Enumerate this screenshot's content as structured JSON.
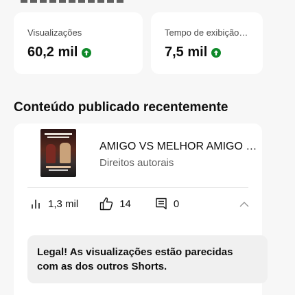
{
  "stats": [
    {
      "label": "Visualizações",
      "value": "60,2 mil",
      "trend_icon": "arrow-up-circle-icon"
    },
    {
      "label": "Tempo de exibição (h...",
      "value": "7,5 mil",
      "trend_icon": "arrow-up-circle-icon"
    }
  ],
  "section": {
    "title": "Conteúdo publicado recentemente"
  },
  "video": {
    "title": "AMIGO VS MELHOR AMIGO @J...",
    "subtitle": "Direitos autorais",
    "views": "1,3 mil",
    "likes": "14",
    "comments": "0"
  },
  "notice": {
    "line1": "Legal! As visualizações estão parecidas",
    "line2": "com as dos outros Shorts."
  },
  "colors": {
    "trend_up": "#0f8a2a",
    "card_bg": "#ffffff",
    "page_bg": "#f7f7f7",
    "notice_bg": "#f0f0f0"
  }
}
